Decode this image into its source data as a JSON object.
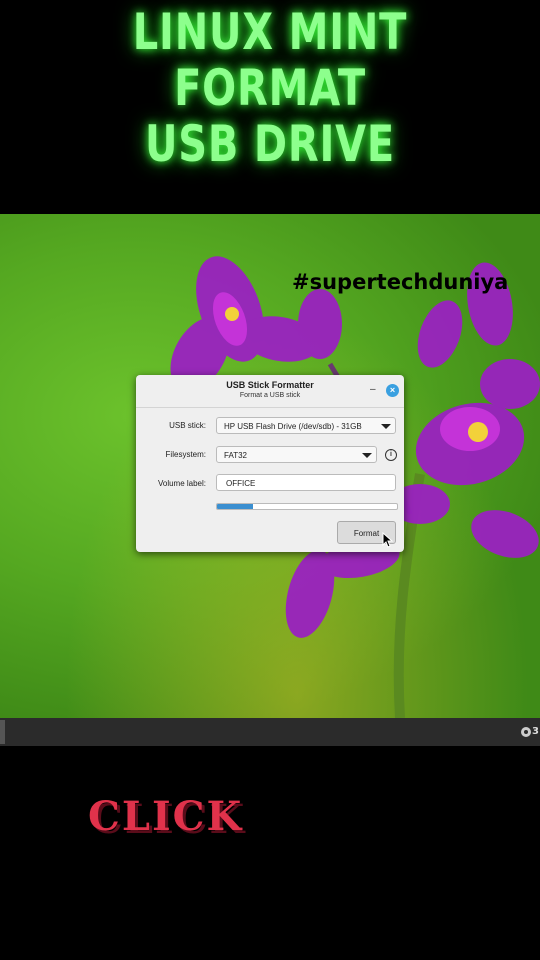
{
  "headline": {
    "line1": "LINUX MINT",
    "line2": "FORMAT",
    "line3": "USB DRIVE"
  },
  "hashtag": "#supertechduniya",
  "dialog": {
    "title": "USB Stick Formatter",
    "subtitle": "Format a USB stick",
    "minimize_icon": "–",
    "close_icon": "×",
    "usb_stick_label": "USB stick:",
    "usb_stick_value": "HP USB Flash Drive (/dev/sdb) - 31GB",
    "filesystem_label": "Filesystem:",
    "filesystem_value": "FAT32",
    "info_icon": "i",
    "volume_label_label": "Volume label:",
    "volume_label_value": "OFFICE",
    "progress_fraction": 0.2,
    "format_button": "Format"
  },
  "taskbar": {
    "tray_text": "3"
  },
  "overlay_text": "CLICK",
  "colors": {
    "headline": "#8dff8d",
    "click": "#e0324b",
    "accent": "#3b8fd0",
    "taskbar": "#2b2b2b"
  }
}
